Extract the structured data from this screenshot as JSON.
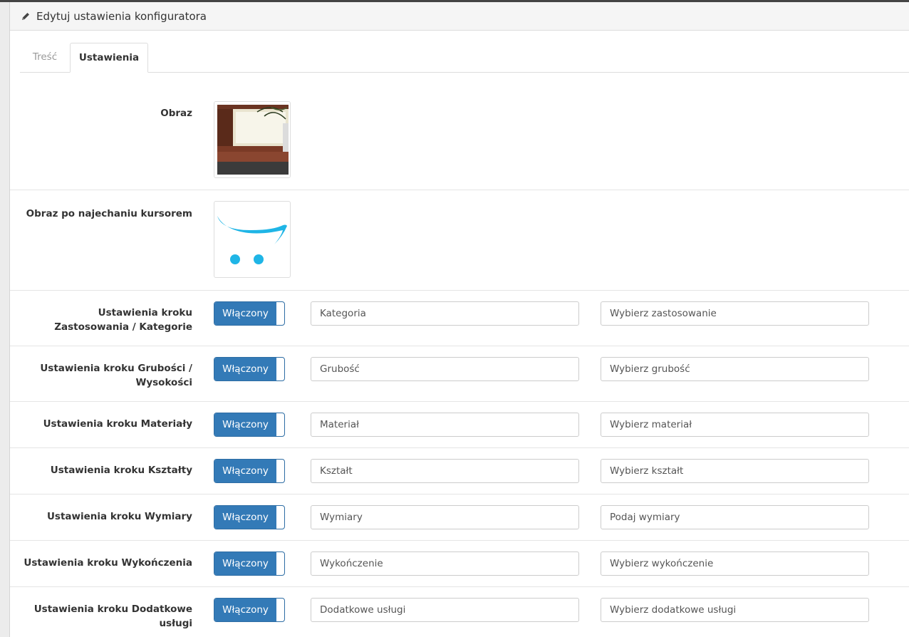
{
  "header": {
    "title": "Edytuj ustawienia konfiguratora",
    "icon": "pencil-icon"
  },
  "tabs": [
    {
      "label": "Treść",
      "active": false
    },
    {
      "label": "Ustawienia",
      "active": true
    }
  ],
  "image_rows": [
    {
      "label": "Obraz"
    },
    {
      "label": "Obraz po najechaniu kursorem"
    }
  ],
  "steps": [
    {
      "label": "Ustawienia kroku Zastosowania / Kategorie",
      "toggle": "Włączony",
      "name_value": "Kategoria",
      "desc_value": "Wybierz zastosowanie"
    },
    {
      "label": "Ustawienia kroku Grubości / Wysokości",
      "toggle": "Włączony",
      "name_value": "Grubość",
      "desc_value": "Wybierz grubość"
    },
    {
      "label": "Ustawienia kroku Materiały",
      "toggle": "Włączony",
      "name_value": "Materiał",
      "desc_value": "Wybierz materiał"
    },
    {
      "label": "Ustawienia kroku Kształty",
      "toggle": "Włączony",
      "name_value": "Kształt",
      "desc_value": "Wybierz kształt"
    },
    {
      "label": "Ustawienia kroku Wymiary",
      "toggle": "Włączony",
      "name_value": "Wymiary",
      "desc_value": "Podaj wymiary"
    },
    {
      "label": "Ustawienia kroku Wykończenia",
      "toggle": "Włączony",
      "name_value": "Wykończenie",
      "desc_value": "Wybierz wykończenie"
    },
    {
      "label": "Ustawienia kroku Dodatkowe usługi",
      "toggle": "Włączony",
      "name_value": "Dodatkowe usługi",
      "desc_value": "Wybierz dodatkowe usługi"
    }
  ],
  "colors": {
    "primary": "#337ab7",
    "cart_accent": "#1fb5e6"
  }
}
